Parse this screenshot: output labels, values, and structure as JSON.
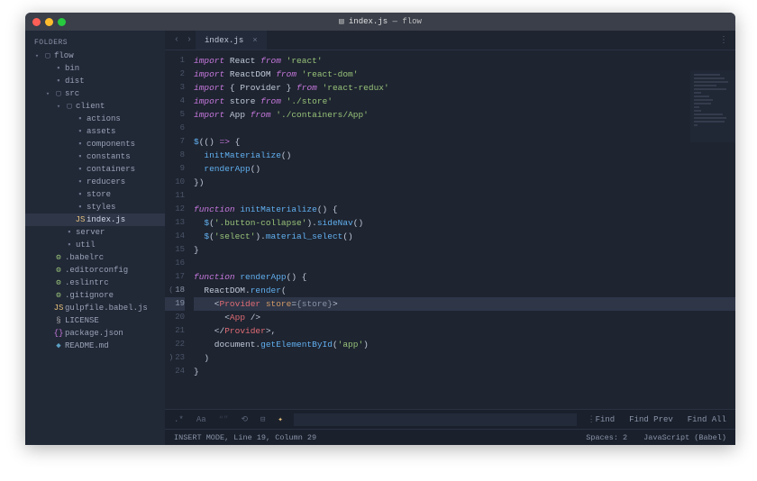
{
  "window": {
    "title_file": "index.js",
    "title_project": "flow"
  },
  "sidebar": {
    "header": "FOLDERS",
    "tree": [
      {
        "depth": 0,
        "kind": "folder-open",
        "label": "flow",
        "arrow": "▾"
      },
      {
        "depth": 1,
        "kind": "folder",
        "label": "bin",
        "arrow": ""
      },
      {
        "depth": 1,
        "kind": "folder",
        "label": "dist",
        "arrow": ""
      },
      {
        "depth": 1,
        "kind": "folder-open",
        "label": "src",
        "arrow": "▾"
      },
      {
        "depth": 2,
        "kind": "folder-open",
        "label": "client",
        "arrow": "▾"
      },
      {
        "depth": 3,
        "kind": "folder",
        "label": "actions",
        "arrow": ""
      },
      {
        "depth": 3,
        "kind": "folder",
        "label": "assets",
        "arrow": ""
      },
      {
        "depth": 3,
        "kind": "folder",
        "label": "components",
        "arrow": ""
      },
      {
        "depth": 3,
        "kind": "folder",
        "label": "constants",
        "arrow": ""
      },
      {
        "depth": 3,
        "kind": "folder",
        "label": "containers",
        "arrow": ""
      },
      {
        "depth": 3,
        "kind": "folder",
        "label": "reducers",
        "arrow": ""
      },
      {
        "depth": 3,
        "kind": "folder",
        "label": "store",
        "arrow": ""
      },
      {
        "depth": 3,
        "kind": "folder",
        "label": "styles",
        "arrow": ""
      },
      {
        "depth": 3,
        "kind": "file-js",
        "label": "index.js",
        "arrow": "",
        "active": true
      },
      {
        "depth": 2,
        "kind": "folder",
        "label": "server",
        "arrow": ""
      },
      {
        "depth": 2,
        "kind": "folder",
        "label": "util",
        "arrow": ""
      },
      {
        "depth": 1,
        "kind": "file-cfg",
        "label": ".babelrc",
        "arrow": ""
      },
      {
        "depth": 1,
        "kind": "file-cfg",
        "label": ".editorconfig",
        "arrow": ""
      },
      {
        "depth": 1,
        "kind": "file-cfg",
        "label": ".eslintrc",
        "arrow": ""
      },
      {
        "depth": 1,
        "kind": "file-cfg",
        "label": ".gitignore",
        "arrow": ""
      },
      {
        "depth": 1,
        "kind": "file-js",
        "label": "gulpfile.babel.js",
        "arrow": ""
      },
      {
        "depth": 1,
        "kind": "file-lic",
        "label": "LICENSE",
        "arrow": ""
      },
      {
        "depth": 1,
        "kind": "file-json",
        "label": "package.json",
        "arrow": ""
      },
      {
        "depth": 1,
        "kind": "file-md",
        "label": "README.md",
        "arrow": ""
      }
    ]
  },
  "tabs": {
    "items": [
      {
        "label": "index.js",
        "active": true
      }
    ]
  },
  "code": {
    "cursor_line": 19,
    "lines": [
      {
        "n": 1,
        "tokens": [
          {
            "t": "import",
            "c": "kw"
          },
          {
            "t": " React "
          },
          {
            "t": "from",
            "c": "kw"
          },
          {
            "t": " "
          },
          {
            "t": "'react'",
            "c": "str"
          }
        ]
      },
      {
        "n": 2,
        "tokens": [
          {
            "t": "import",
            "c": "kw"
          },
          {
            "t": " ReactDOM "
          },
          {
            "t": "from",
            "c": "kw"
          },
          {
            "t": " "
          },
          {
            "t": "'react-dom'",
            "c": "str"
          }
        ]
      },
      {
        "n": 3,
        "tokens": [
          {
            "t": "import",
            "c": "kw"
          },
          {
            "t": " { Provider } "
          },
          {
            "t": "from",
            "c": "kw"
          },
          {
            "t": " "
          },
          {
            "t": "'react-redux'",
            "c": "str"
          }
        ]
      },
      {
        "n": 4,
        "tokens": [
          {
            "t": "import",
            "c": "kw"
          },
          {
            "t": " store "
          },
          {
            "t": "from",
            "c": "kw"
          },
          {
            "t": " "
          },
          {
            "t": "'./store'",
            "c": "str"
          }
        ]
      },
      {
        "n": 5,
        "tokens": [
          {
            "t": "import",
            "c": "kw"
          },
          {
            "t": " App "
          },
          {
            "t": "from",
            "c": "kw"
          },
          {
            "t": " "
          },
          {
            "t": "'./containers/App'",
            "c": "str"
          }
        ]
      },
      {
        "n": 6,
        "tokens": []
      },
      {
        "n": 7,
        "tokens": [
          {
            "t": "$",
            "c": "fn"
          },
          {
            "t": "(() "
          },
          {
            "t": "=>",
            "c": "kw"
          },
          {
            "t": " {"
          }
        ]
      },
      {
        "n": 8,
        "tokens": [
          {
            "t": "  "
          },
          {
            "t": "initMaterialize",
            "c": "fn"
          },
          {
            "t": "()"
          }
        ]
      },
      {
        "n": 9,
        "tokens": [
          {
            "t": "  "
          },
          {
            "t": "renderApp",
            "c": "fn"
          },
          {
            "t": "()"
          }
        ]
      },
      {
        "n": 10,
        "tokens": [
          {
            "t": "})"
          }
        ]
      },
      {
        "n": 11,
        "tokens": []
      },
      {
        "n": 12,
        "tokens": [
          {
            "t": "function",
            "c": "kw"
          },
          {
            "t": " "
          },
          {
            "t": "initMaterialize",
            "c": "fn"
          },
          {
            "t": "() {"
          }
        ]
      },
      {
        "n": 13,
        "tokens": [
          {
            "t": "  "
          },
          {
            "t": "$",
            "c": "fn"
          },
          {
            "t": "("
          },
          {
            "t": "'.button-collapse'",
            "c": "str"
          },
          {
            "t": ")."
          },
          {
            "t": "sideNav",
            "c": "fn"
          },
          {
            "t": "()"
          }
        ]
      },
      {
        "n": 14,
        "tokens": [
          {
            "t": "  "
          },
          {
            "t": "$",
            "c": "fn"
          },
          {
            "t": "("
          },
          {
            "t": "'select'",
            "c": "str"
          },
          {
            "t": ")."
          },
          {
            "t": "material_select",
            "c": "fn"
          },
          {
            "t": "()"
          }
        ]
      },
      {
        "n": 15,
        "tokens": [
          {
            "t": "}"
          }
        ]
      },
      {
        "n": 16,
        "tokens": []
      },
      {
        "n": 17,
        "tokens": [
          {
            "t": "function",
            "c": "kw"
          },
          {
            "t": " "
          },
          {
            "t": "renderApp",
            "c": "fn"
          },
          {
            "t": "() {"
          }
        ]
      },
      {
        "n": 18,
        "tokens": [
          {
            "t": "  ReactDOM."
          },
          {
            "t": "render",
            "c": "fn"
          },
          {
            "t": "("
          }
        ],
        "paren": "("
      },
      {
        "n": 19,
        "tokens": [
          {
            "t": "    <"
          },
          {
            "t": "Provider",
            "c": "tag"
          },
          {
            "t": " "
          },
          {
            "t": "store",
            "c": "attr"
          },
          {
            "t": "="
          },
          {
            "t": "{store}",
            "c": "punc"
          },
          {
            "t": ">"
          }
        ],
        "hl": true
      },
      {
        "n": 20,
        "tokens": [
          {
            "t": "      <"
          },
          {
            "t": "App",
            "c": "tag"
          },
          {
            "t": " />"
          }
        ]
      },
      {
        "n": 21,
        "tokens": [
          {
            "t": "    </"
          },
          {
            "t": "Provider",
            "c": "tag"
          },
          {
            "t": ">,"
          }
        ]
      },
      {
        "n": 22,
        "tokens": [
          {
            "t": "    document."
          },
          {
            "t": "getElementById",
            "c": "fn"
          },
          {
            "t": "("
          },
          {
            "t": "'app'",
            "c": "str"
          },
          {
            "t": ")"
          }
        ]
      },
      {
        "n": 23,
        "tokens": [
          {
            "t": "  )"
          }
        ],
        "paren": ")"
      },
      {
        "n": 24,
        "tokens": [
          {
            "t": "}"
          }
        ]
      }
    ]
  },
  "bottombar": {
    "find": "Find",
    "find_prev": "Find Prev",
    "find_all": "Find All"
  },
  "status": {
    "left": "INSERT MODE, Line 19, Column 29",
    "spaces": "Spaces: 2",
    "lang": "JavaScript (Babel)"
  }
}
